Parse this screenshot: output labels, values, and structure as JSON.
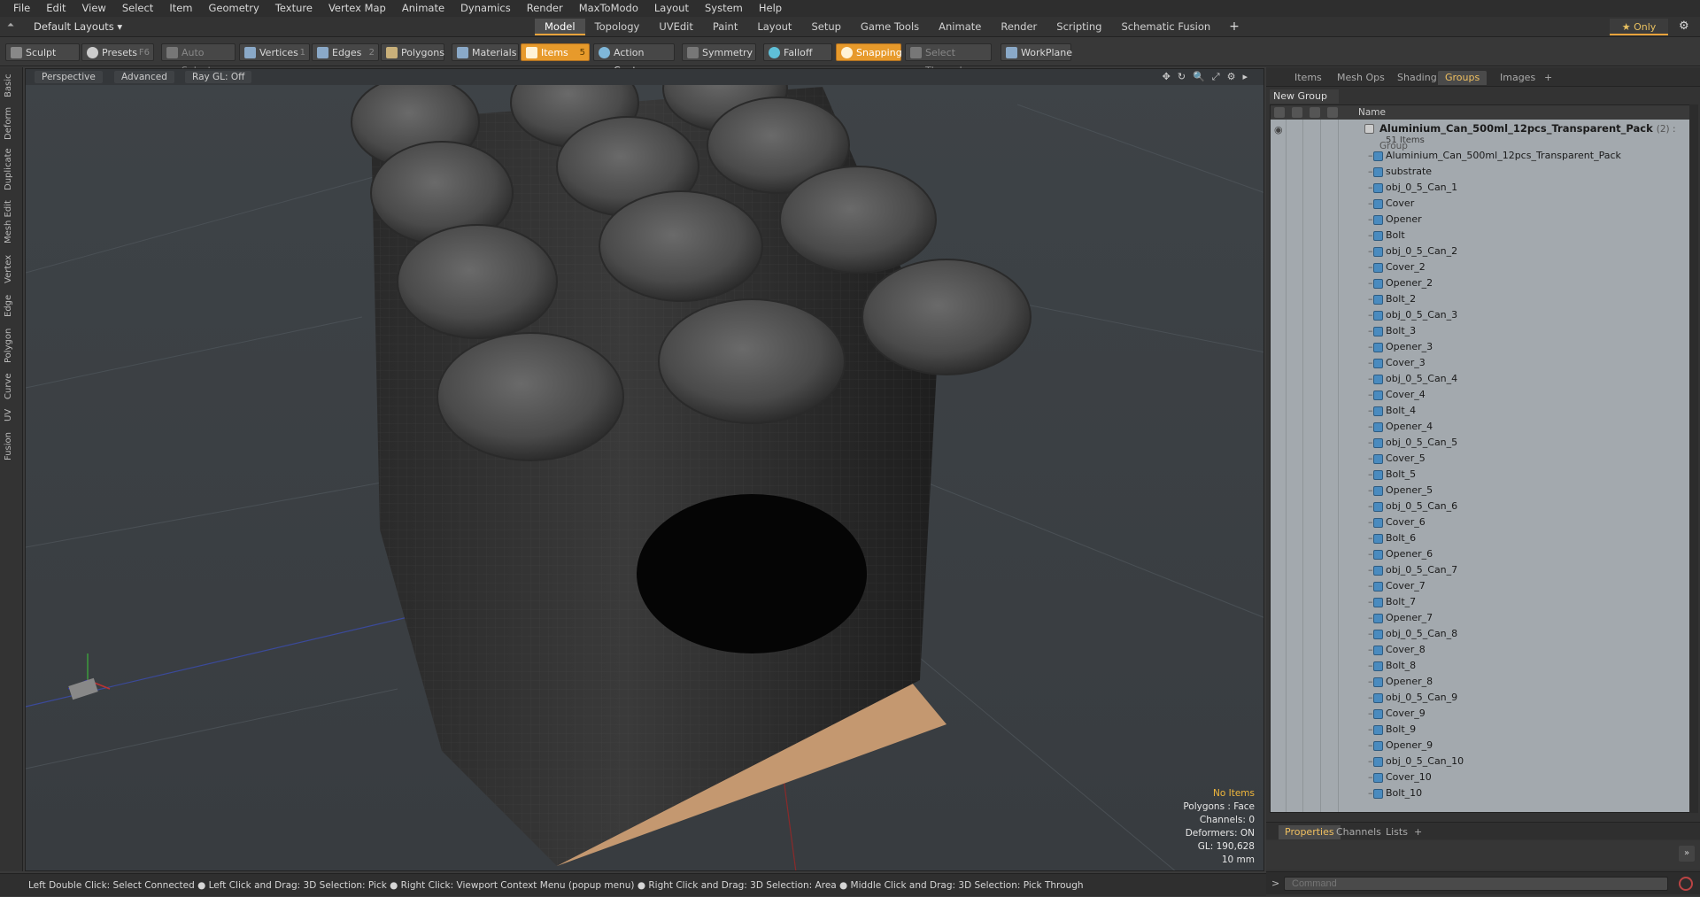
{
  "menubar": {
    "items": [
      "File",
      "Edit",
      "View",
      "Select",
      "Item",
      "Geometry",
      "Texture",
      "Vertex Map",
      "Animate",
      "Dynamics",
      "Render",
      "MaxToModo",
      "Layout",
      "System",
      "Help"
    ]
  },
  "layoutbar": {
    "layouts_label": "Default Layouts ▾",
    "tabs": [
      "Model",
      "Topology",
      "UVEdit",
      "Paint",
      "Layout",
      "Setup",
      "Game Tools",
      "Animate",
      "Render",
      "Scripting",
      "Schematic Fusion"
    ],
    "active_tab": "Model",
    "plus": "+",
    "only_label": "★ Only",
    "gear": "⚙"
  },
  "toolbar": {
    "sculpt": "Sculpt",
    "presets": "Presets",
    "presets_key": "F6",
    "auto_select": "Auto Select",
    "vertices": "Vertices",
    "vertices_count": "1",
    "edges": "Edges",
    "edges_count": "2",
    "polygons": "Polygons",
    "materials": "Materials",
    "items": "Items",
    "items_count": "5",
    "action_center": "Action Center",
    "symmetry": "Symmetry",
    "falloff": "Falloff",
    "snapping": "Snapping",
    "select_through": "Select Through",
    "workplane": "WorkPlane"
  },
  "left_tabs": [
    "Basic",
    "Deform",
    "Duplicate",
    "Mesh Edit",
    "Vertex",
    "Edge",
    "Polygon",
    "Curve",
    "UV",
    "Fusion"
  ],
  "viewport": {
    "view_mode": "Perspective",
    "shading": "Advanced",
    "raygl": "Ray GL: Off",
    "icons": [
      "✥",
      "↻",
      "🔍",
      "⤢",
      "⚙",
      "▸"
    ],
    "info": {
      "no_items": "No Items",
      "polygons": "Polygons : Face",
      "channels": "Channels: 0",
      "deformers": "Deformers: ON",
      "gl": "GL: 190,628",
      "unit": "10 mm"
    }
  },
  "statusbar": {
    "text": "Left Double Click: Select Connected ● Left Click and Drag: 3D Selection: Pick ● Right Click: Viewport Context Menu (popup menu) ● Right Click and Drag: 3D Selection: Area ● Middle Click and Drag: 3D Selection: Pick Through"
  },
  "right_panel": {
    "tabs": [
      "Items",
      "Mesh Ops",
      "Shading",
      "Groups",
      "Images",
      "+"
    ],
    "active_tab": "Groups",
    "new_group": "New Group",
    "column_name": "Name",
    "group": {
      "name": "Aluminium_Can_500ml_12pcs_Transparent_Pack",
      "suffix": "(2) : Group",
      "count": "51 Items"
    },
    "items": [
      "Aluminium_Can_500ml_12pcs_Transparent_Pack",
      "substrate",
      "obj_0_5_Can_1",
      "Cover",
      "Opener",
      "Bolt",
      "obj_0_5_Can_2",
      "Cover_2",
      "Opener_2",
      "Bolt_2",
      "obj_0_5_Can_3",
      "Bolt_3",
      "Opener_3",
      "Cover_3",
      "obj_0_5_Can_4",
      "Cover_4",
      "Bolt_4",
      "Opener_4",
      "obj_0_5_Can_5",
      "Cover_5",
      "Bolt_5",
      "Opener_5",
      "obj_0_5_Can_6",
      "Cover_6",
      "Bolt_6",
      "Opener_6",
      "obj_0_5_Can_7",
      "Cover_7",
      "Bolt_7",
      "Opener_7",
      "obj_0_5_Can_8",
      "Cover_8",
      "Bolt_8",
      "Opener_8",
      "obj_0_5_Can_9",
      "Cover_9",
      "Bolt_9",
      "Opener_9",
      "obj_0_5_Can_10",
      "Cover_10",
      "Bolt_10"
    ],
    "prop_tabs": [
      "Properties",
      "Channels",
      "Lists",
      "+"
    ],
    "active_prop_tab": "Properties",
    "expand_arrow": "»",
    "command_placeholder": "Command",
    "command_prompt": ">"
  },
  "colors": {
    "accent": "#e79a2b",
    "tree_bg": "#a3a9ae",
    "viewport_bg": "#3c4145",
    "mesh_icon": "#4a8bbf"
  }
}
